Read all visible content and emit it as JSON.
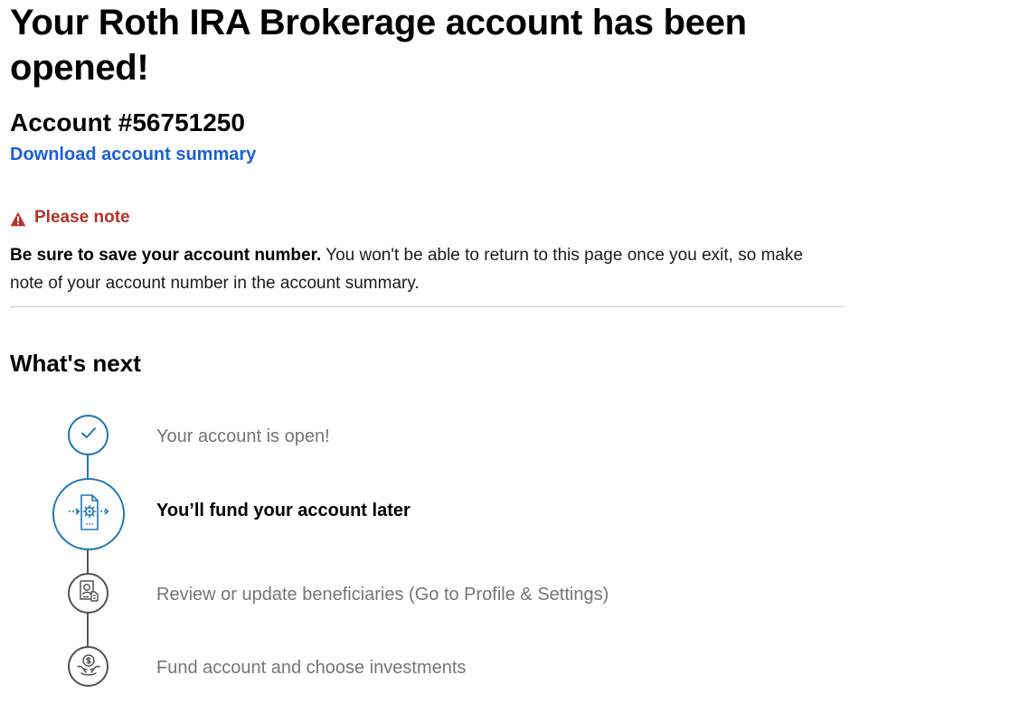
{
  "page": {
    "title": "Your Roth IRA Brokerage account has been opened!",
    "account_number": "Account #56751250",
    "download_link": "Download account summary"
  },
  "note": {
    "heading": "Please note",
    "body_bold": "Be sure to save your account number.",
    "body_text": " You won't be able to return to this page once you exit, so make note of your account number in the account summary."
  },
  "whats_next": {
    "heading": "What's next",
    "steps": [
      {
        "label": "Your account is open!",
        "status": "complete",
        "icon": "check-icon"
      },
      {
        "label": "You’ll fund your account later",
        "status": "current",
        "icon": "document-gear-icon"
      },
      {
        "label": "Review or update beneficiaries (Go to Profile & Settings)",
        "status": "upcoming",
        "icon": "beneficiary-icon"
      },
      {
        "label": "Fund account and choose investments",
        "status": "upcoming",
        "icon": "hands-money-icon"
      }
    ]
  },
  "colors": {
    "link": "#1a5fd6",
    "warning": "#b4342a",
    "step_active": "#1f78b4",
    "step_inactive": "#555555"
  }
}
